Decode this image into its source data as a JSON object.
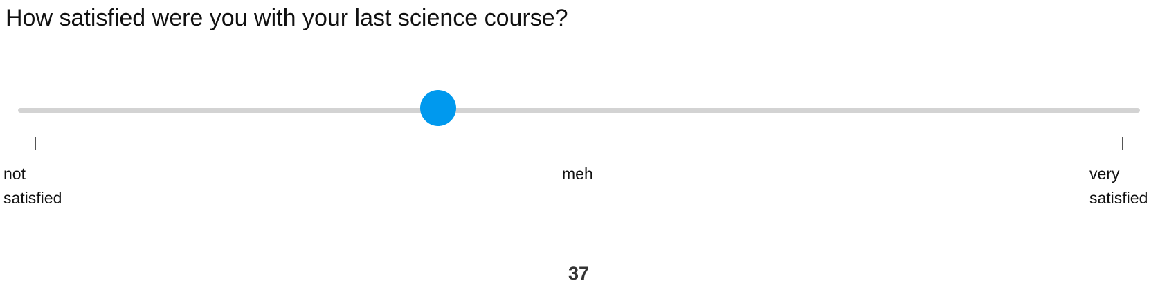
{
  "question": "How satisfied were you with your last science course?",
  "slider": {
    "min": 0,
    "max": 100,
    "value": 37,
    "accent_color": "#0099ee",
    "track_color": "#d3d3d3"
  },
  "ticks": [
    {
      "value": 0,
      "label_line1": "not",
      "label_line2": "satisfied"
    },
    {
      "value": 50,
      "label_line1": "meh",
      "label_line2": ""
    },
    {
      "value": 100,
      "label_line1": "very",
      "label_line2": "satisfied"
    }
  ],
  "value_display": "37"
}
